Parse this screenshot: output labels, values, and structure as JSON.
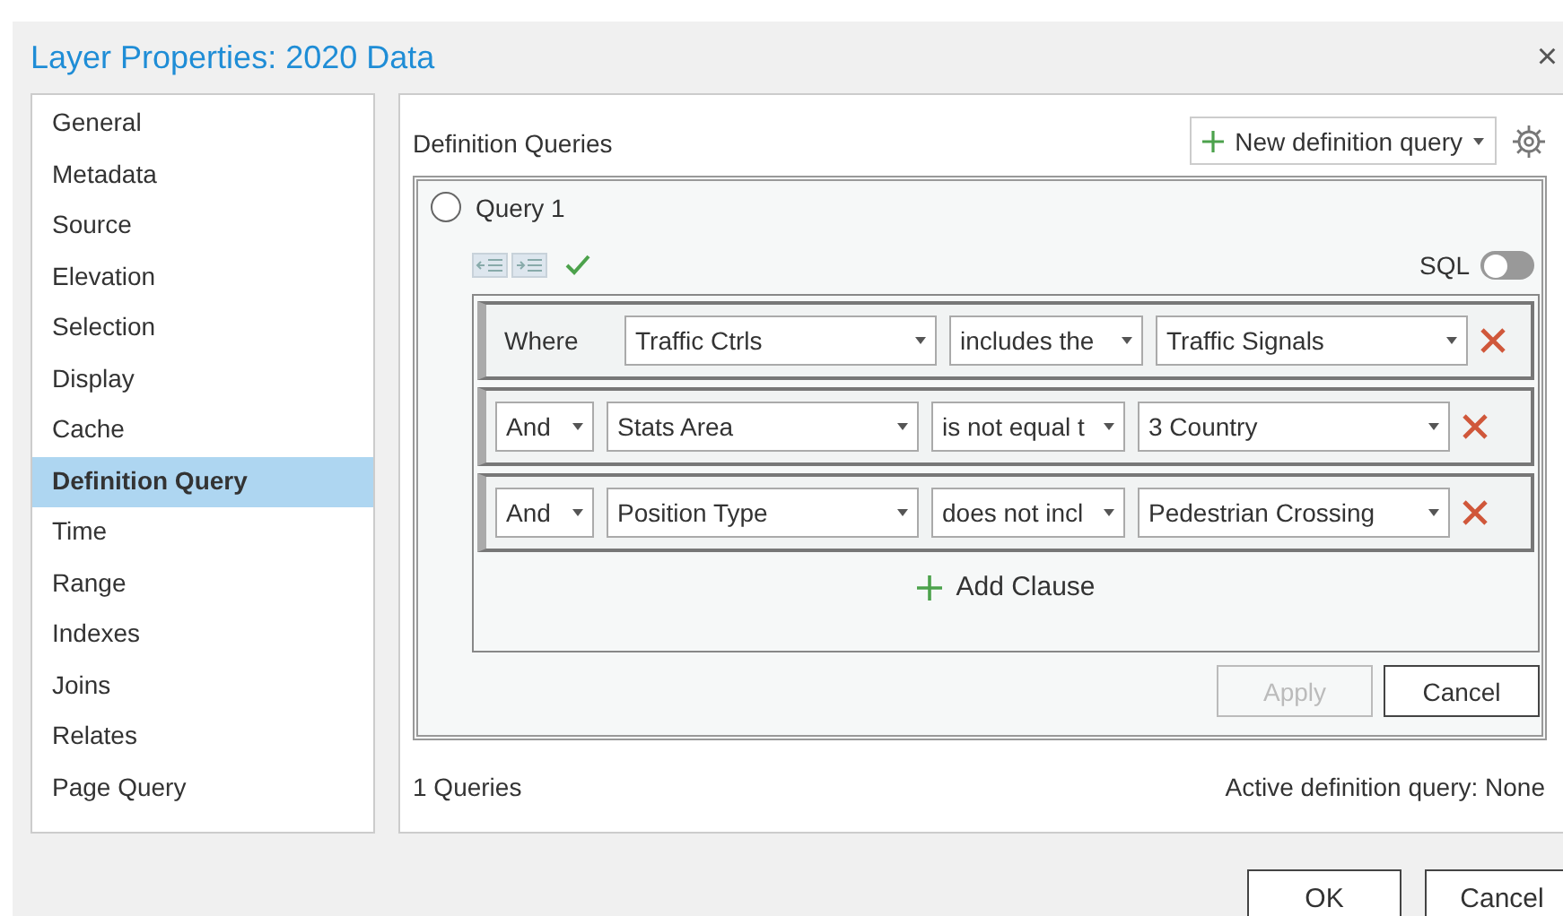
{
  "window": {
    "title": "Layer Properties: 2020 Data",
    "close": "×"
  },
  "sidebar": {
    "items": [
      {
        "label": "General",
        "selected": false
      },
      {
        "label": "Metadata",
        "selected": false
      },
      {
        "label": "Source",
        "selected": false
      },
      {
        "label": "Elevation",
        "selected": false
      },
      {
        "label": "Selection",
        "selected": false
      },
      {
        "label": "Display",
        "selected": false
      },
      {
        "label": "Cache",
        "selected": false
      },
      {
        "label": "Definition Query",
        "selected": true
      },
      {
        "label": "Time",
        "selected": false
      },
      {
        "label": "Range",
        "selected": false
      },
      {
        "label": "Indexes",
        "selected": false
      },
      {
        "label": "Joins",
        "selected": false
      },
      {
        "label": "Relates",
        "selected": false
      },
      {
        "label": "Page Query",
        "selected": false
      }
    ]
  },
  "panel": {
    "heading": "Definition Queries",
    "new_query_button": "New definition query",
    "query": {
      "name": "Query 1",
      "selected": false,
      "sql_toggle": {
        "label": "SQL",
        "on": false
      },
      "clauses": [
        {
          "kind": "label",
          "connector": "Where",
          "field": "Traffic Ctrls",
          "operator": "includes the",
          "value": "Traffic Signals"
        },
        {
          "kind": "dropdown",
          "connector": "And",
          "field": "Stats Area",
          "operator": "is not equal t",
          "value": "3 Country"
        },
        {
          "kind": "dropdown",
          "connector": "And",
          "field": "Position Type",
          "operator": "does not incl",
          "value": "Pedestrian Crossing"
        }
      ],
      "add_clause": "Add Clause",
      "apply": {
        "label": "Apply",
        "disabled": true
      },
      "cancel": "Cancel"
    },
    "count": "1 Queries",
    "active": "Active definition query: None"
  },
  "buttons": [
    "OK",
    "Cancel"
  ]
}
